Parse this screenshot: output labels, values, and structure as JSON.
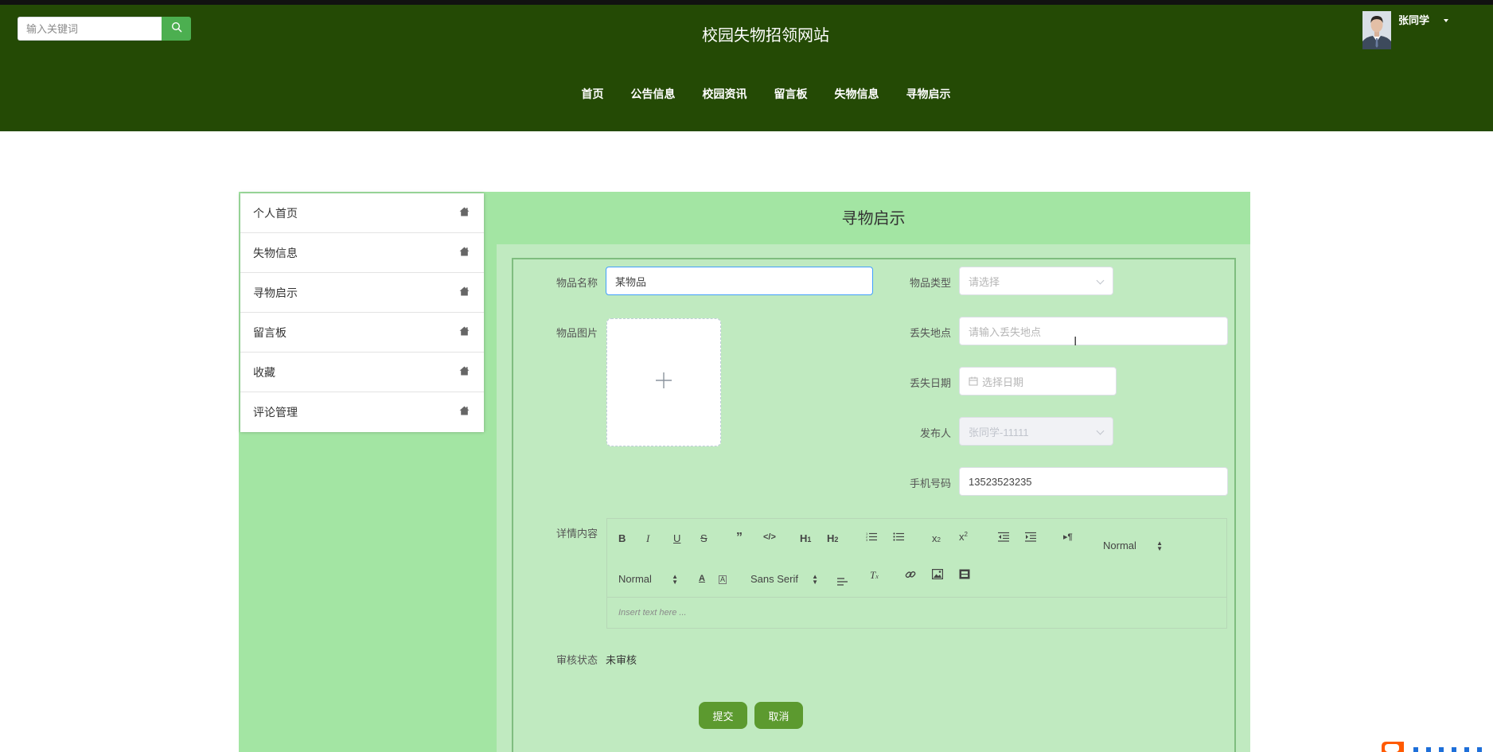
{
  "header": {
    "site_title": "校园失物招领网站",
    "search_placeholder": "输入关键词",
    "username": "张同学",
    "nav": [
      "首页",
      "公告信息",
      "校园资讯",
      "留言板",
      "失物信息",
      "寻物启示"
    ]
  },
  "sidebar": {
    "items": [
      {
        "label": "个人首页",
        "icon": "home-icon"
      },
      {
        "label": "失物信息",
        "icon": "home-icon"
      },
      {
        "label": "寻物启示",
        "icon": "home-icon"
      },
      {
        "label": "留言板",
        "icon": "home-icon"
      },
      {
        "label": "收藏",
        "icon": "home-icon"
      },
      {
        "label": "评论管理",
        "icon": "home-icon"
      }
    ]
  },
  "form": {
    "title": "寻物启示",
    "item_name": {
      "label": "物品名称",
      "value": "某物品"
    },
    "item_type": {
      "label": "物品类型",
      "placeholder": "请选择"
    },
    "item_image": {
      "label": "物品图片"
    },
    "lost_place": {
      "label": "丢失地点",
      "placeholder": "请输入丢失地点"
    },
    "lost_date": {
      "label": "丢失日期",
      "placeholder": "选择日期"
    },
    "publisher": {
      "label": "发布人",
      "value": "张同学-11111"
    },
    "phone": {
      "label": "手机号码",
      "value": "13523523235"
    },
    "detail": {
      "label": "详情内容",
      "placeholder": "Insert text here ...",
      "header_select": "Normal",
      "size_select": "Normal",
      "font_select": "Sans Serif"
    },
    "review_status": {
      "label": "审核状态",
      "value": "未审核"
    },
    "submit_label": "提交",
    "cancel_label": "取消"
  },
  "colors": {
    "header_bg": "#244a05",
    "panel_bg": "#a3e5a3",
    "form_bg": "#c0eac0",
    "button": "#5c9a2f",
    "search_button": "#4caf50"
  }
}
